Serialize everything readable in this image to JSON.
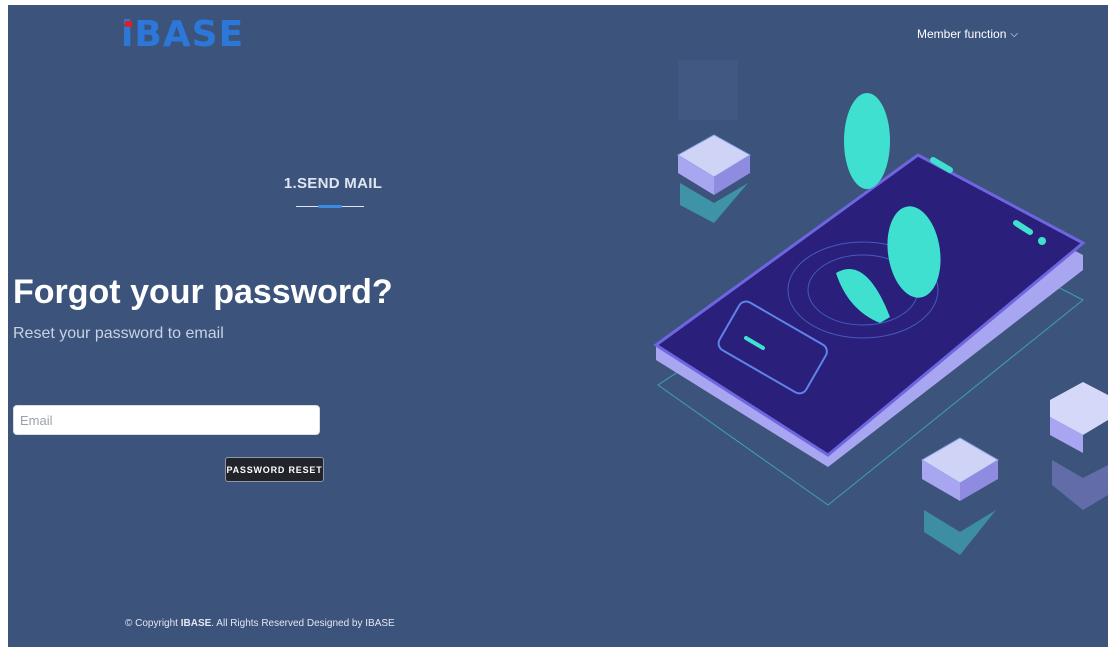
{
  "header": {
    "logo_text": "iBASE",
    "member_menu_label": "Member function",
    "member_menu_icon": "chevron-down-icon"
  },
  "steps": {
    "current_label": "1.SEND MAIL"
  },
  "form": {
    "heading": "Forgot your password?",
    "subheading": "Reset your password to email",
    "email_value": "",
    "email_placeholder": "Email",
    "submit_label": "PASSWORD RESET"
  },
  "footer": {
    "prefix": "© Copyright ",
    "brand": "IBASE",
    "suffix": ". All Rights Reserved Designed by IBASE"
  },
  "colors": {
    "background": "#3c537c",
    "logo_blue": "#2c78d8",
    "logo_red": "#e02020",
    "accent_cyan": "#3fe0d0",
    "phone_purple": "#2a1f7a",
    "button_dark": "#22242b"
  }
}
